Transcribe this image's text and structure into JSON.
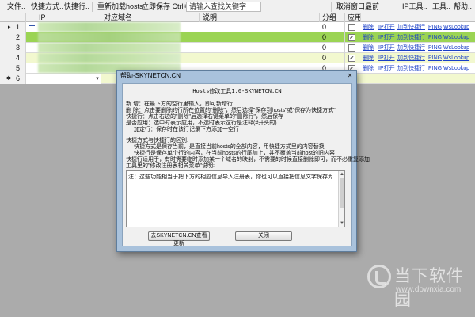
{
  "toolbar": {
    "items": [
      "文件..",
      "快捷方式..",
      "快捷行..",
      "重新加载hosts",
      "立即保存 Ctrl+S",
      "请输入查找关键字",
      "取消窗口最前",
      "IP工具..",
      "工具..",
      "帮助.."
    ]
  },
  "grid": {
    "columns": [
      "IP",
      "对应域名",
      "说明",
      "分组",
      "应用"
    ],
    "rows": [
      {
        "num": "1",
        "group": "0",
        "checked": false,
        "current": true
      },
      {
        "num": "2",
        "group": "0",
        "checked": true
      },
      {
        "num": "3",
        "group": "0",
        "checked": false
      },
      {
        "num": "4",
        "group": "0",
        "checked": true
      },
      {
        "num": "5",
        "group": "0",
        "checked": true
      },
      {
        "num": "6",
        "group": "",
        "checked": false,
        "new_row": true
      }
    ],
    "row_marker_current": "▸",
    "row_marker_new": "✱",
    "links": [
      "删除",
      "IP打开",
      "加到快捷行",
      "PING",
      "WsLookup"
    ]
  },
  "dialog": {
    "title": "帮助-SKYNETCN.CN",
    "close": "✕",
    "heading": "Hosts修改工具1.0-SKYNETCN.CN",
    "lines": [
      "新    增：在最下方的空行里输入，即可新增行",
      "删    除：点击要删除的行所在位置的\"删除\"，然后选择\"保存到hosts\"或\"保存为快捷方式\"",
      "快捷行：点击右边的\"删除\"后选择右键菜单的\"删除行\"，然后保存",
      "是否应用：选中时表示应用，不选时表示这行是注释(#开头的)",
      "加定行：保存时在该行记录下方添加一空行",
      "",
      "快捷方式与快捷行的区别:",
      "快捷方式是保存当前，是直接当前hosts的全部内容，用快捷方式里的内容替换",
      "快捷行是保存单个行的内容，在当前hosts的行尾加上，并不覆盖当前host的旧内容",
      "快捷行适用于，有时需要临时添加某一个域名的映射，不需要的时候直接删除即可，而不必重复添加",
      "",
      "工具里的\"修改注册表相关菜单\"说明:"
    ],
    "textarea": "注：这些功能相当于把下方的相应信息导入注册表，你也可以直接把信息文字保存为.reg文件",
    "btn_visit": "去SKYNETCN.CN查看更新",
    "btn_close": "关闭"
  },
  "watermark": {
    "text": "当下软件园",
    "url": "www.downxia.com"
  }
}
